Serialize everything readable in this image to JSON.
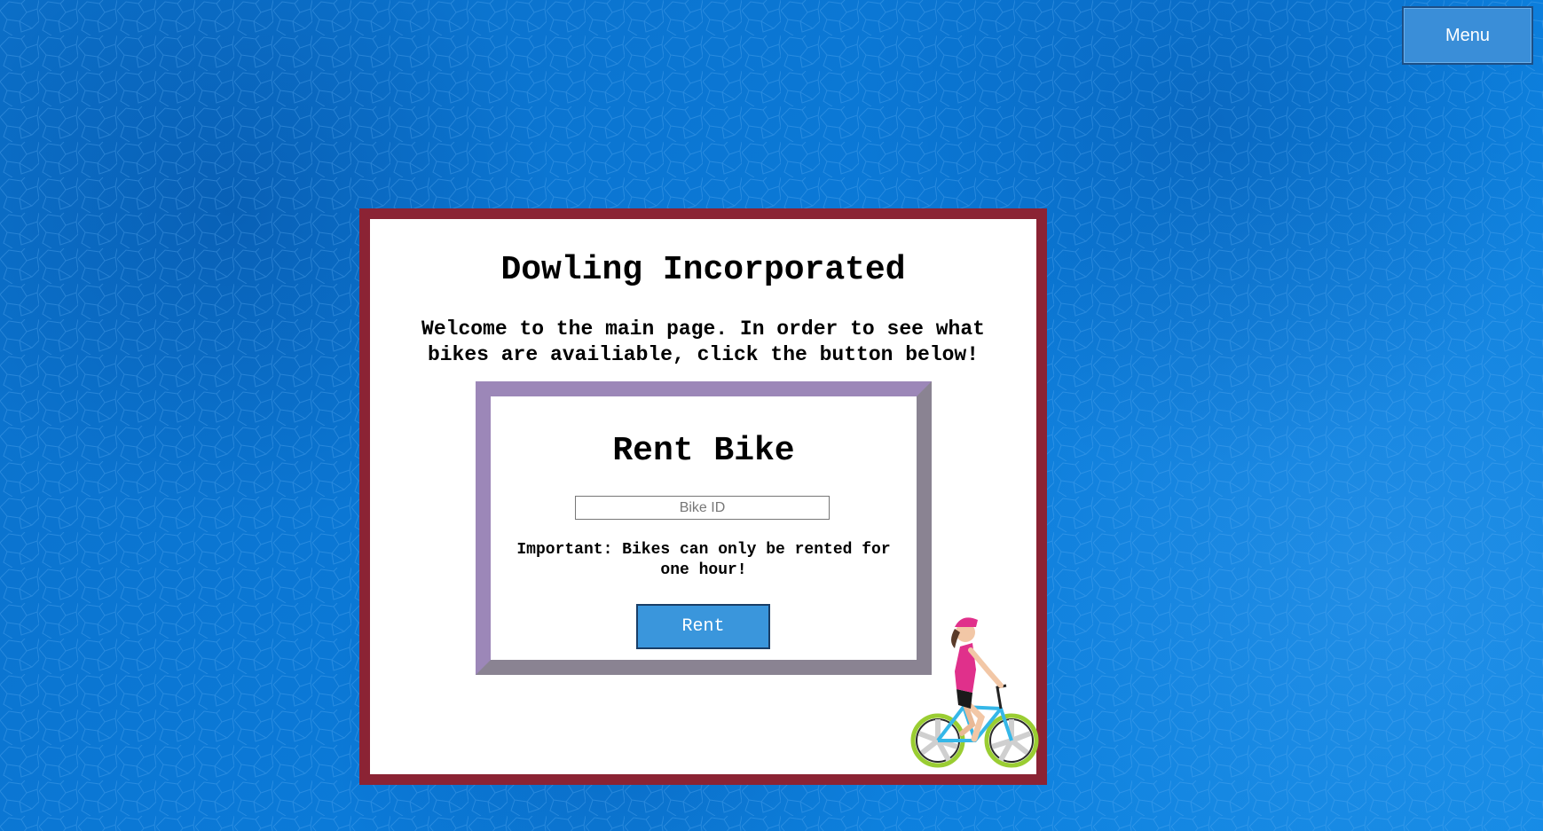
{
  "header": {
    "menu_label": "Menu"
  },
  "main": {
    "title": "Dowling Incorporated",
    "welcome_text": "Welcome to the main page. In order to see what bikes are availiable, click the button below!",
    "rent_form": {
      "title": "Rent Bike",
      "bike_id_placeholder": "Bike ID",
      "bike_id_value": "",
      "note": "Important: Bikes can only be rented for one hour!",
      "rent_label": "Rent"
    }
  },
  "illustration": {
    "icon": "cyclist-icon"
  },
  "colors": {
    "background": "#0a78d6",
    "card_border": "#8b2334",
    "panel_border": "#9c87b8",
    "button": "#3a96dc"
  }
}
